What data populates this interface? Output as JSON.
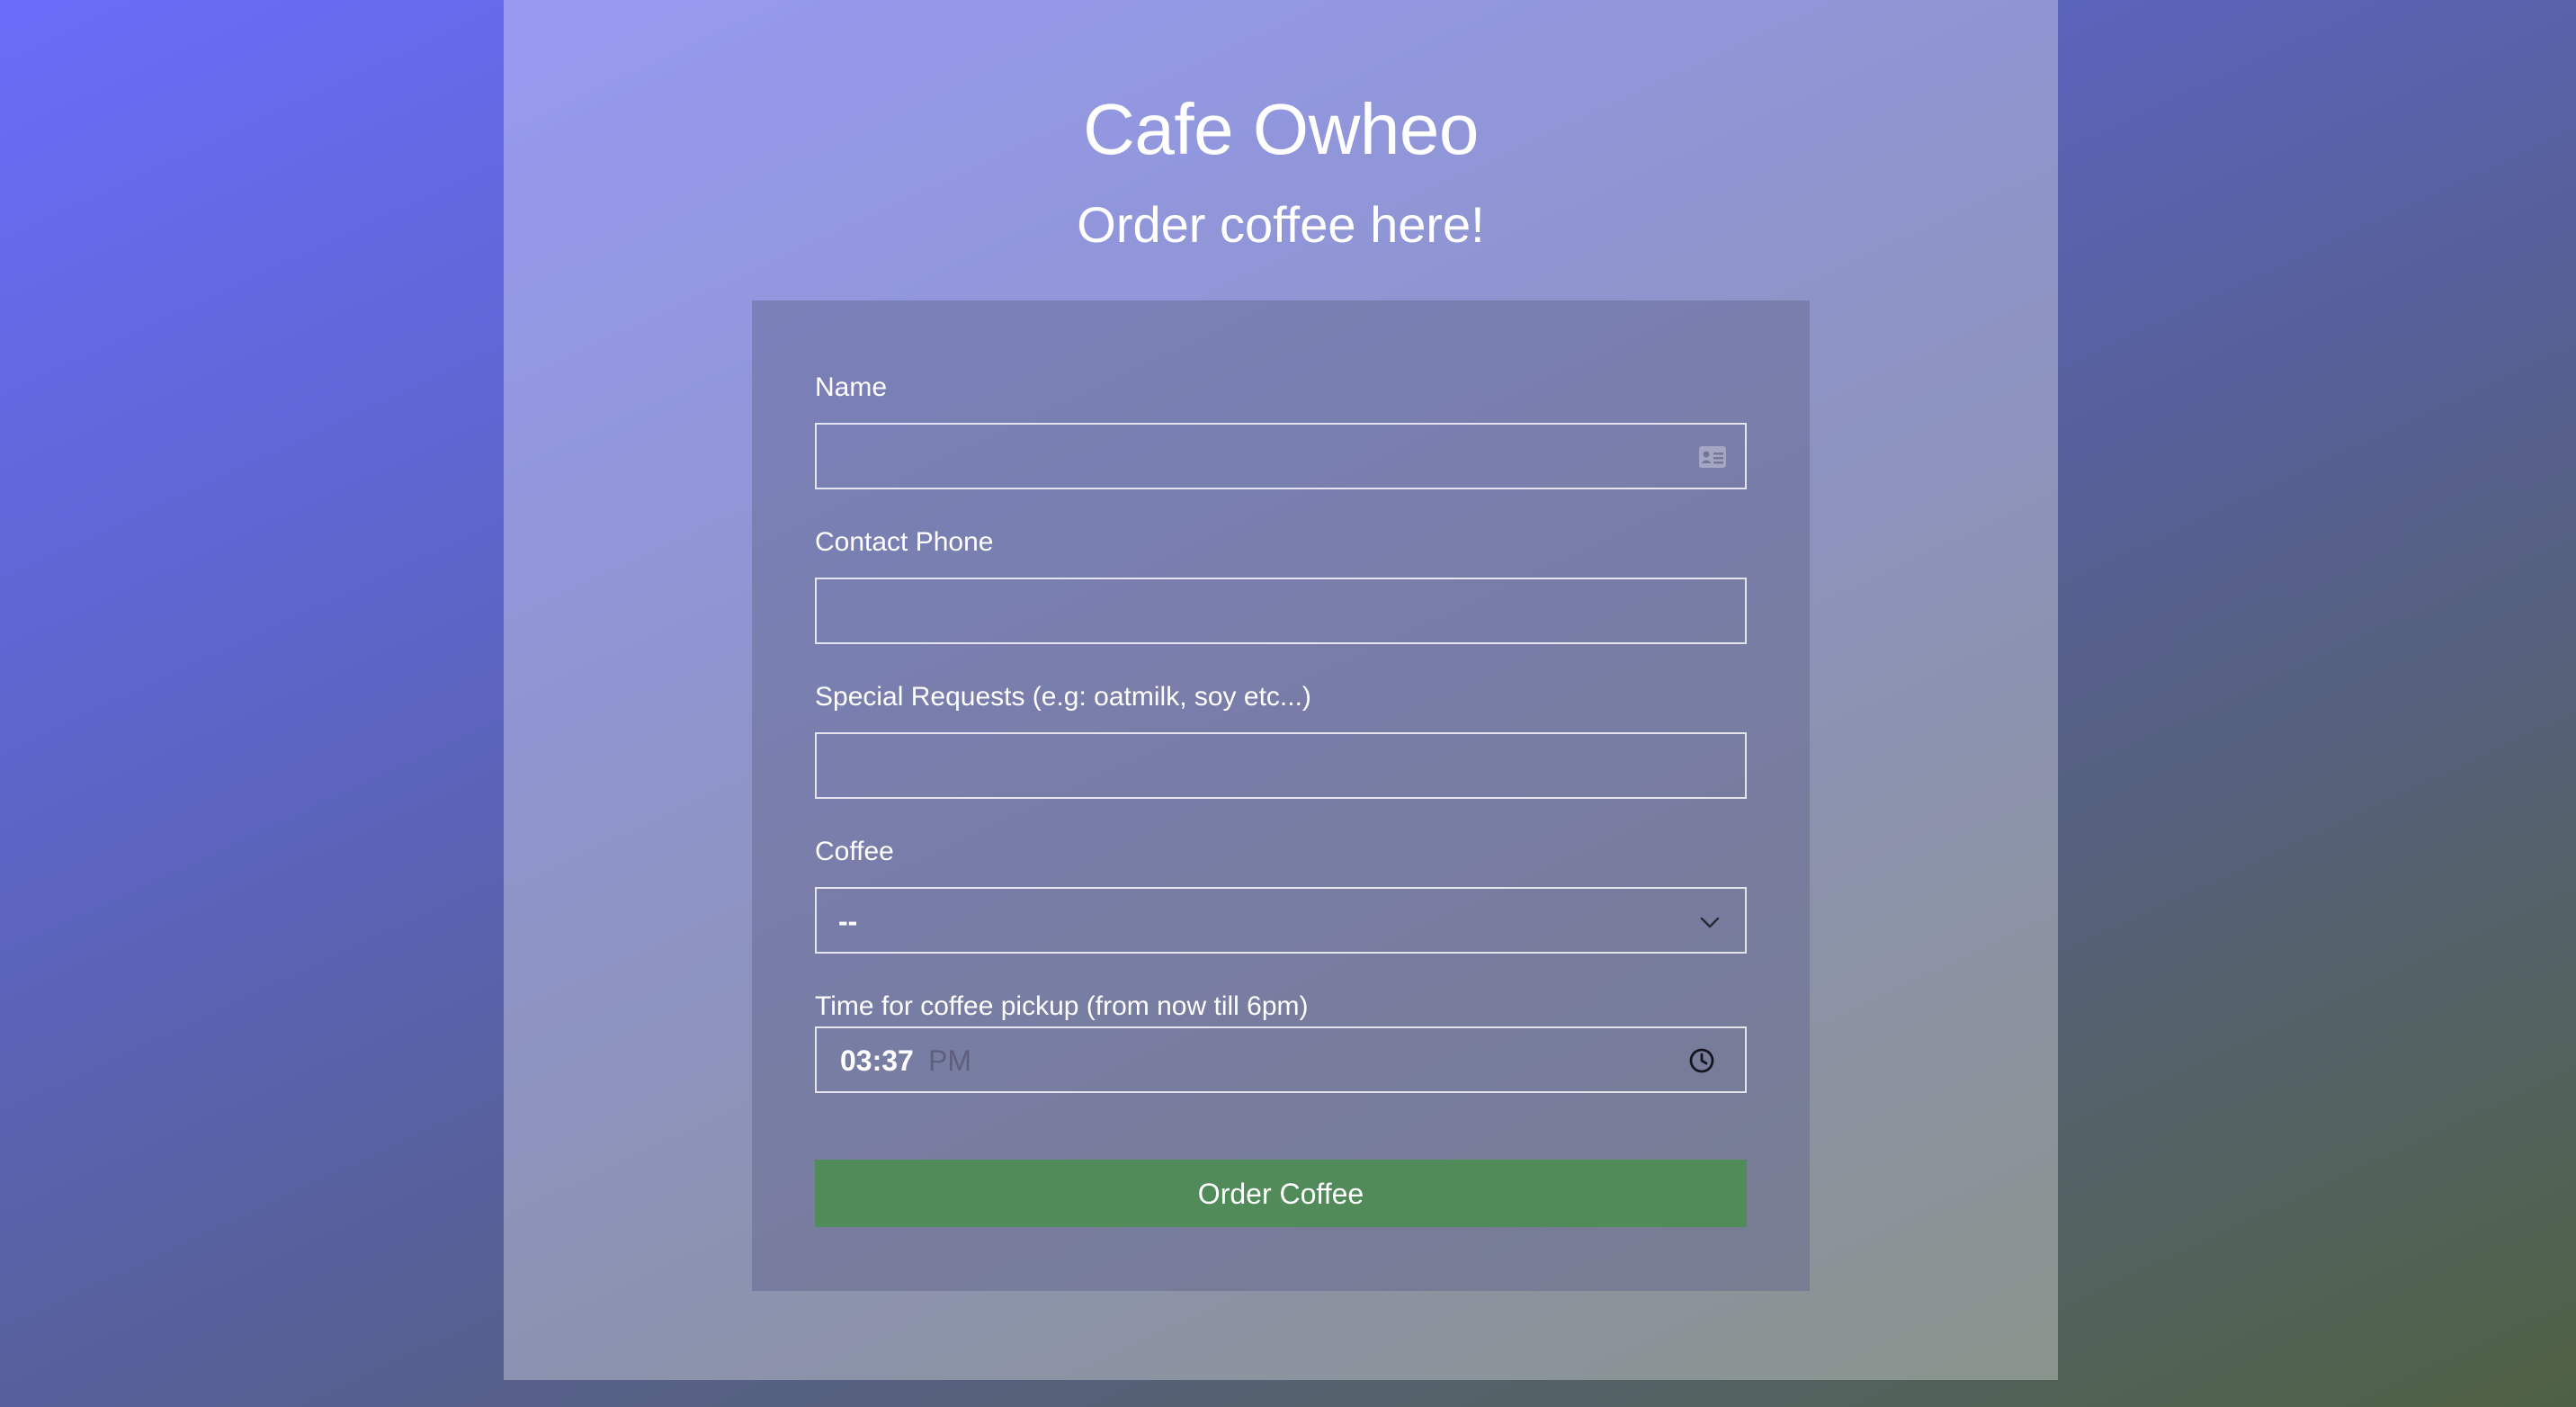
{
  "header": {
    "title": "Cafe Owheo",
    "subtitle": "Order coffee here!"
  },
  "form": {
    "name": {
      "label": "Name",
      "value": "",
      "icon": "contact-card-icon"
    },
    "phone": {
      "label": "Contact Phone",
      "value": ""
    },
    "requests": {
      "label": "Special Requests (e.g: oatmilk, soy etc...)",
      "value": ""
    },
    "coffee": {
      "label": "Coffee",
      "selected": "--",
      "icon": "chevron-down-icon"
    },
    "pickup_time": {
      "label": "Time for coffee pickup (from now till 6pm)",
      "time": "03:37",
      "period": "PM",
      "icon": "clock-icon"
    },
    "submit_label": "Order Coffee"
  },
  "colors": {
    "button": "#518b5a",
    "text": "#ffffff"
  }
}
